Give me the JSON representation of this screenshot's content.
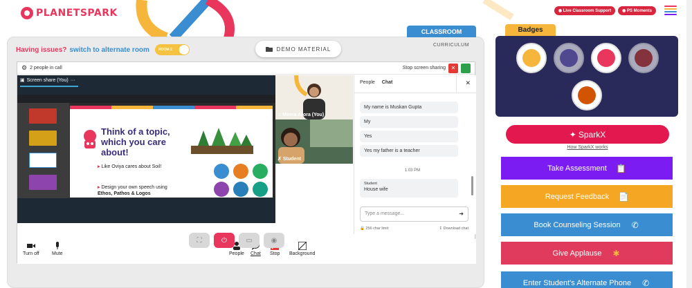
{
  "brand": {
    "logo_text": "PLANETSPARK"
  },
  "header": {
    "live_support": "Live Classroom Support",
    "ps_moments": "PS Moments"
  },
  "classroom": {
    "tab_label": "CLASSROOM",
    "curriculum_label": "CURRICULUM",
    "issue_text": "Having issues?",
    "switch_link": "switch to alternate room",
    "room_toggle": "ROOM 2",
    "demo_material": "DEMO MATERIAL"
  },
  "call": {
    "people_count": "2 people in call",
    "stop_share": "Stop screen sharing",
    "screen_share_label": "Screen share (You)",
    "participants": [
      {
        "name": "Meera Arora (You)"
      },
      {
        "name": "Student"
      }
    ]
  },
  "slide": {
    "title": "Think of a topic, which you care about!",
    "bullet1": "Like Oviya cares about Soil!",
    "bullet2_line1": "Design your own speech using",
    "bullet2_line2": "Ethos, Pathos & Logos"
  },
  "chat": {
    "tab_people": "People",
    "tab_chat": "Chat",
    "messages": [
      "My name is Muskan Gupta",
      "My",
      "Yes",
      "Yes my father is a teacher"
    ],
    "time": "1:03 PM",
    "last_sender": "Student",
    "last_message": "House wife",
    "input_placeholder": "Type a message...",
    "char_limit": "256 char limit",
    "download": "Download chat"
  },
  "controls": {
    "turn_off": "Turn off",
    "mute": "Mute",
    "people": "People",
    "chat": "Chat",
    "stop": "Stop",
    "background": "Background"
  },
  "sidebar": {
    "badges_title": "Badges",
    "sparkx": "SparkX",
    "how_sparkx": "How SparkX works",
    "actions": [
      {
        "label": "Take Assessment",
        "color": "#7b1df2"
      },
      {
        "label": "Request Feedback",
        "color": "#f5a623"
      },
      {
        "label": "Book Counseling Session",
        "color": "#3a8dd0"
      },
      {
        "label": "Give Applause",
        "color": "#e03a5c"
      },
      {
        "label": "Enter Student's Alternate Phone",
        "color": "#3a8dd0"
      }
    ]
  },
  "colors": {
    "brand_pink": "#e8365d",
    "blue": "#3a8dd0",
    "badge_bg": "#2a2a5a"
  }
}
